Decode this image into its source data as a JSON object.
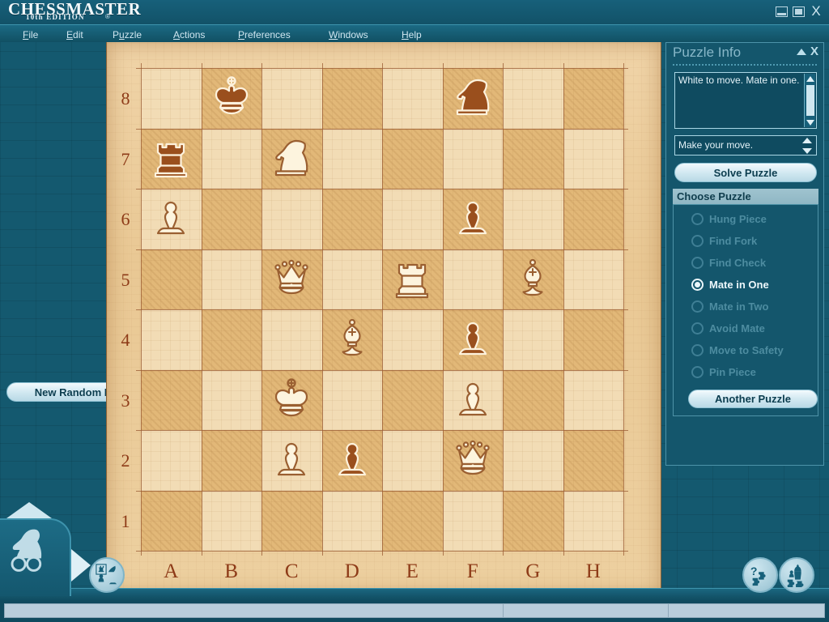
{
  "app": {
    "logo_line1": "CHESSMASTER",
    "logo_line2": "10th EDITION",
    "logo_reg": "®"
  },
  "window_controls": {
    "minimize": "minimize-button",
    "maximize": "maximize-button",
    "close": "X"
  },
  "menu": {
    "items": [
      {
        "label": "File",
        "accel": "F"
      },
      {
        "label": "Edit",
        "accel": "E"
      },
      {
        "label": "Puzzle",
        "accel": "P"
      },
      {
        "label": "Actions",
        "accel": "A"
      },
      {
        "label": "Preferences",
        "accel": "P"
      },
      {
        "label": "Windows",
        "accel": "W"
      },
      {
        "label": "Help",
        "accel": "H"
      }
    ]
  },
  "board": {
    "files": [
      "A",
      "B",
      "C",
      "D",
      "E",
      "F",
      "G",
      "H"
    ],
    "ranks": [
      "8",
      "7",
      "6",
      "5",
      "4",
      "3",
      "2",
      "1"
    ],
    "pieces": [
      {
        "square": "B8",
        "color": "black",
        "type": "king"
      },
      {
        "square": "F8",
        "color": "black",
        "type": "knight"
      },
      {
        "square": "A7",
        "color": "black",
        "type": "rook"
      },
      {
        "square": "C7",
        "color": "white",
        "type": "knight"
      },
      {
        "square": "A6",
        "color": "white",
        "type": "pawn"
      },
      {
        "square": "F6",
        "color": "black",
        "type": "pawn"
      },
      {
        "square": "C5",
        "color": "white",
        "type": "queen"
      },
      {
        "square": "E5",
        "color": "white",
        "type": "rook"
      },
      {
        "square": "G5",
        "color": "white",
        "type": "bishop"
      },
      {
        "square": "D4",
        "color": "white",
        "type": "bishop"
      },
      {
        "square": "F4",
        "color": "black",
        "type": "pawn"
      },
      {
        "square": "C3",
        "color": "white",
        "type": "king"
      },
      {
        "square": "F3",
        "color": "white",
        "type": "pawn"
      },
      {
        "square": "C2",
        "color": "white",
        "type": "pawn"
      },
      {
        "square": "D2",
        "color": "black",
        "type": "pawn"
      },
      {
        "square": "F2",
        "color": "white",
        "type": "queen"
      }
    ],
    "colors": {
      "light_square": "#f2dcb5",
      "dark_square": "#e2b878",
      "border": "#e8c491",
      "label": "#8e3b18",
      "white_piece": "#fdf4de",
      "black_piece": "#9a4f1d"
    }
  },
  "panel": {
    "title": "Puzzle Info",
    "collapse_icon": "triangle-up-icon",
    "close_label": "X",
    "info_text": "White to move. Mate in one.",
    "move_prompt": "Make your move.",
    "solve_label": "Solve Puzzle",
    "choose_header": "Choose Puzzle",
    "puzzle_types": [
      {
        "label": "Hung Piece",
        "selected": false
      },
      {
        "label": "Find Fork",
        "selected": false
      },
      {
        "label": "Find Check",
        "selected": false
      },
      {
        "label": "Mate in One",
        "selected": true
      },
      {
        "label": "Mate in Two",
        "selected": false
      },
      {
        "label": "Avoid Mate",
        "selected": false
      },
      {
        "label": "Move to Safety",
        "selected": false
      },
      {
        "label": "Pin Piece",
        "selected": false
      }
    ],
    "another_label": "Another Puzzle",
    "new_random_label": "New Random Puzzle"
  },
  "taskbar": {
    "knight_icon": "knight-logo-icon",
    "expand_icon": "triangle-up-icon",
    "play_icon": "play-triangle-icon",
    "pieces_button": "chess-pieces-icon",
    "help_button": "help-puzzle-icon",
    "puzzle_button": "puzzle-pieces-icon"
  },
  "statusbar": {
    "pane1": "",
    "pane2": "",
    "pane3": ""
  },
  "theme": {
    "chrome": "#14566c",
    "chrome_light": "#1b6a84",
    "accent": "#bcdfeb",
    "button": "#cfe7f0"
  }
}
